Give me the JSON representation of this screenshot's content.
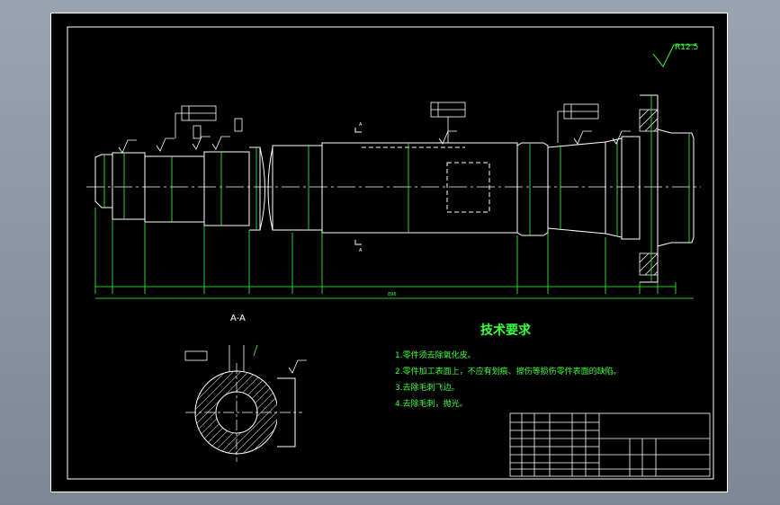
{
  "drawing": {
    "roughness_symbol": "R12.5",
    "section_title": "A-A",
    "tech_title": "技术要求",
    "requirements": [
      "1.零件须去除氧化皮。",
      "2.零件加工表面上，不应有划痕、擦伤等损伤零件表面的缺陷。",
      "3.去除毛刺飞边。",
      "4.去除毛刺，抛光。"
    ],
    "overall_length_label": "896",
    "section_marker": "A"
  },
  "colors": {
    "background": "#000000",
    "outline": "#ffffff",
    "dimension": "#3cff3c",
    "text": "#ffffff"
  }
}
